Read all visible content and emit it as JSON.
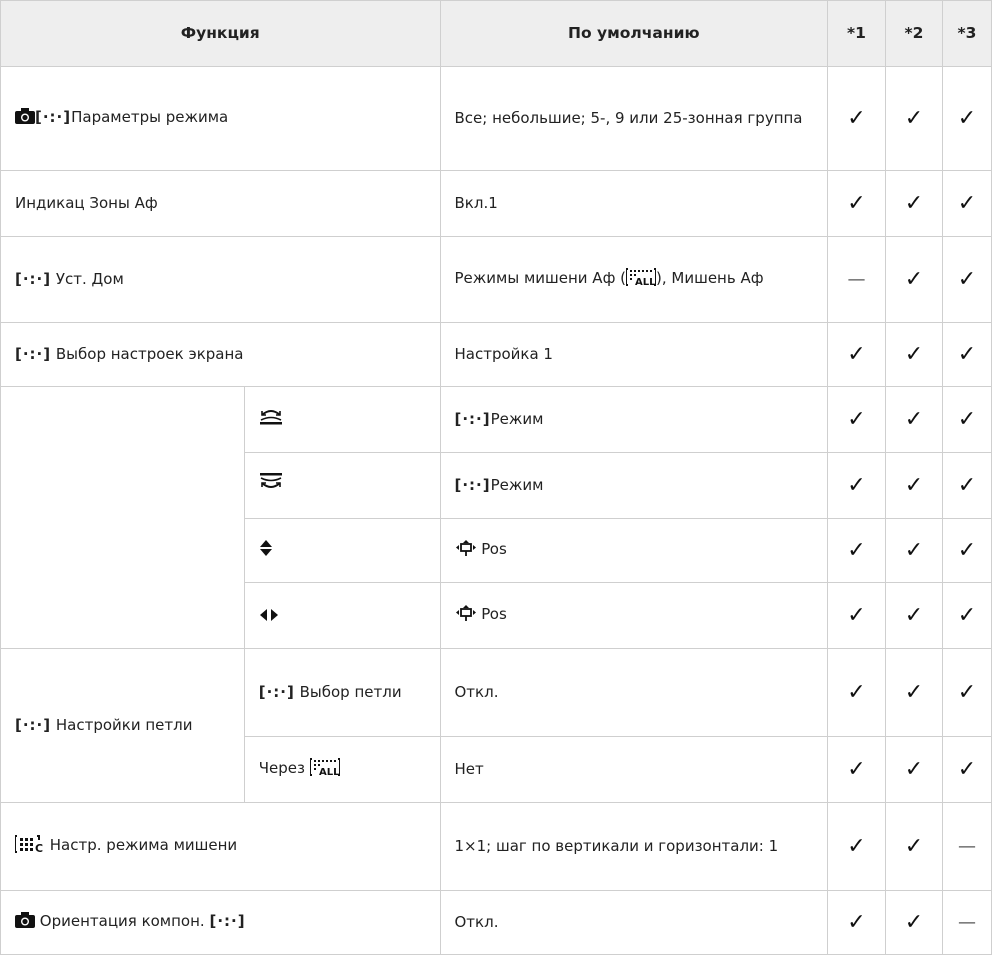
{
  "header": {
    "function": "Функция",
    "default": "По умолчанию",
    "c1": "*1",
    "c2": "*2",
    "c3": "*3"
  },
  "marks": {
    "check": "✓",
    "dash": "—"
  },
  "af_bracket": "[·:·]",
  "rows": {
    "r1": {
      "label": "Параметры режима",
      "default": "Все; небольшие; 5-, 9 или 25-зонная группа"
    },
    "r2": {
      "label": "Индикац Зоны Аф",
      "default": "Вкл.1"
    },
    "r3": {
      "label": "Уст. Дом",
      "default_a": "Режимы мишени Аф (",
      "default_b": "), Мишень Аф"
    },
    "r4": {
      "label": "Выбор настроек экрана",
      "default": "Настройка 1"
    },
    "r5": {
      "default": "Режим"
    },
    "r6": {
      "default": "Режим"
    },
    "r7": {
      "default": "Pos"
    },
    "r8": {
      "default": "Pos"
    },
    "r9": {
      "group": "Настройки петли",
      "sub": "Выбор петли",
      "default": "Откл."
    },
    "r10": {
      "sub": "Через",
      "default": "Нет"
    },
    "r11": {
      "label": "Настр. режима мишени",
      "default": "1×1; шаг по вертикали и горизонтали: 1"
    },
    "r12": {
      "label": "Ориентация компон.",
      "default": "Откл."
    }
  }
}
